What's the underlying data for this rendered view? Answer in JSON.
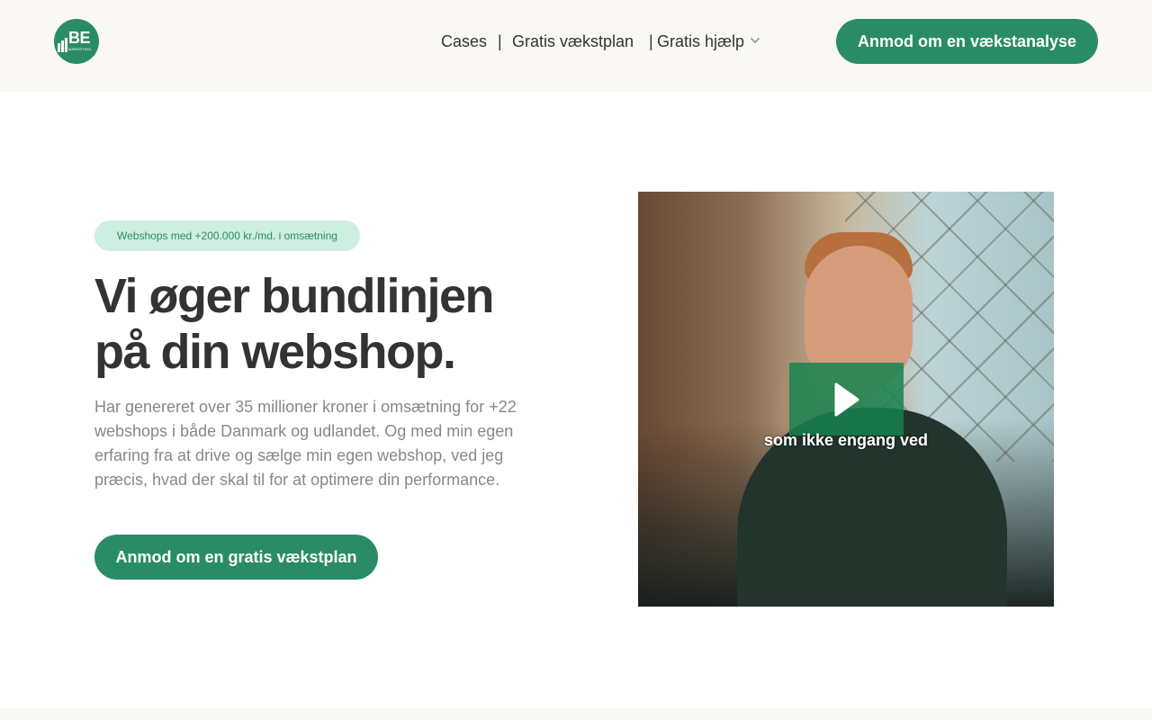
{
  "header": {
    "logo": {
      "text": "BE",
      "subtext": "MARKETING"
    },
    "nav": [
      {
        "label": "Cases"
      },
      {
        "label": "Gratis vækstplan"
      },
      {
        "label": "Gratis hjælp",
        "has_dropdown": true
      }
    ],
    "nav_separator": "|",
    "cta_label": "Anmod om en vækstanalyse"
  },
  "hero": {
    "badge": "Webshops med +200.000 kr./md. i omsætning",
    "headline_line1": "Vi øger bundlinjen",
    "headline_line2": "på din webshop.",
    "description": "Har genereret over 35 millioner kroner i omsætning for +22 webshops i både Danmark og udlandet. Og med min egen erfaring fra at drive og sælge min egen webshop, ved jeg præcis, hvad der skal til for at optimere din performance.",
    "cta_label": "Anmod om en gratis vækstplan"
  },
  "video": {
    "subtitle": "som ikke engang ved",
    "play_icon": "play-icon"
  },
  "colors": {
    "brand_green": "#2a8c66",
    "badge_bg": "#cdeee0",
    "header_bg": "#f9f8f4",
    "heading_text": "#333333",
    "body_text": "#888888"
  }
}
